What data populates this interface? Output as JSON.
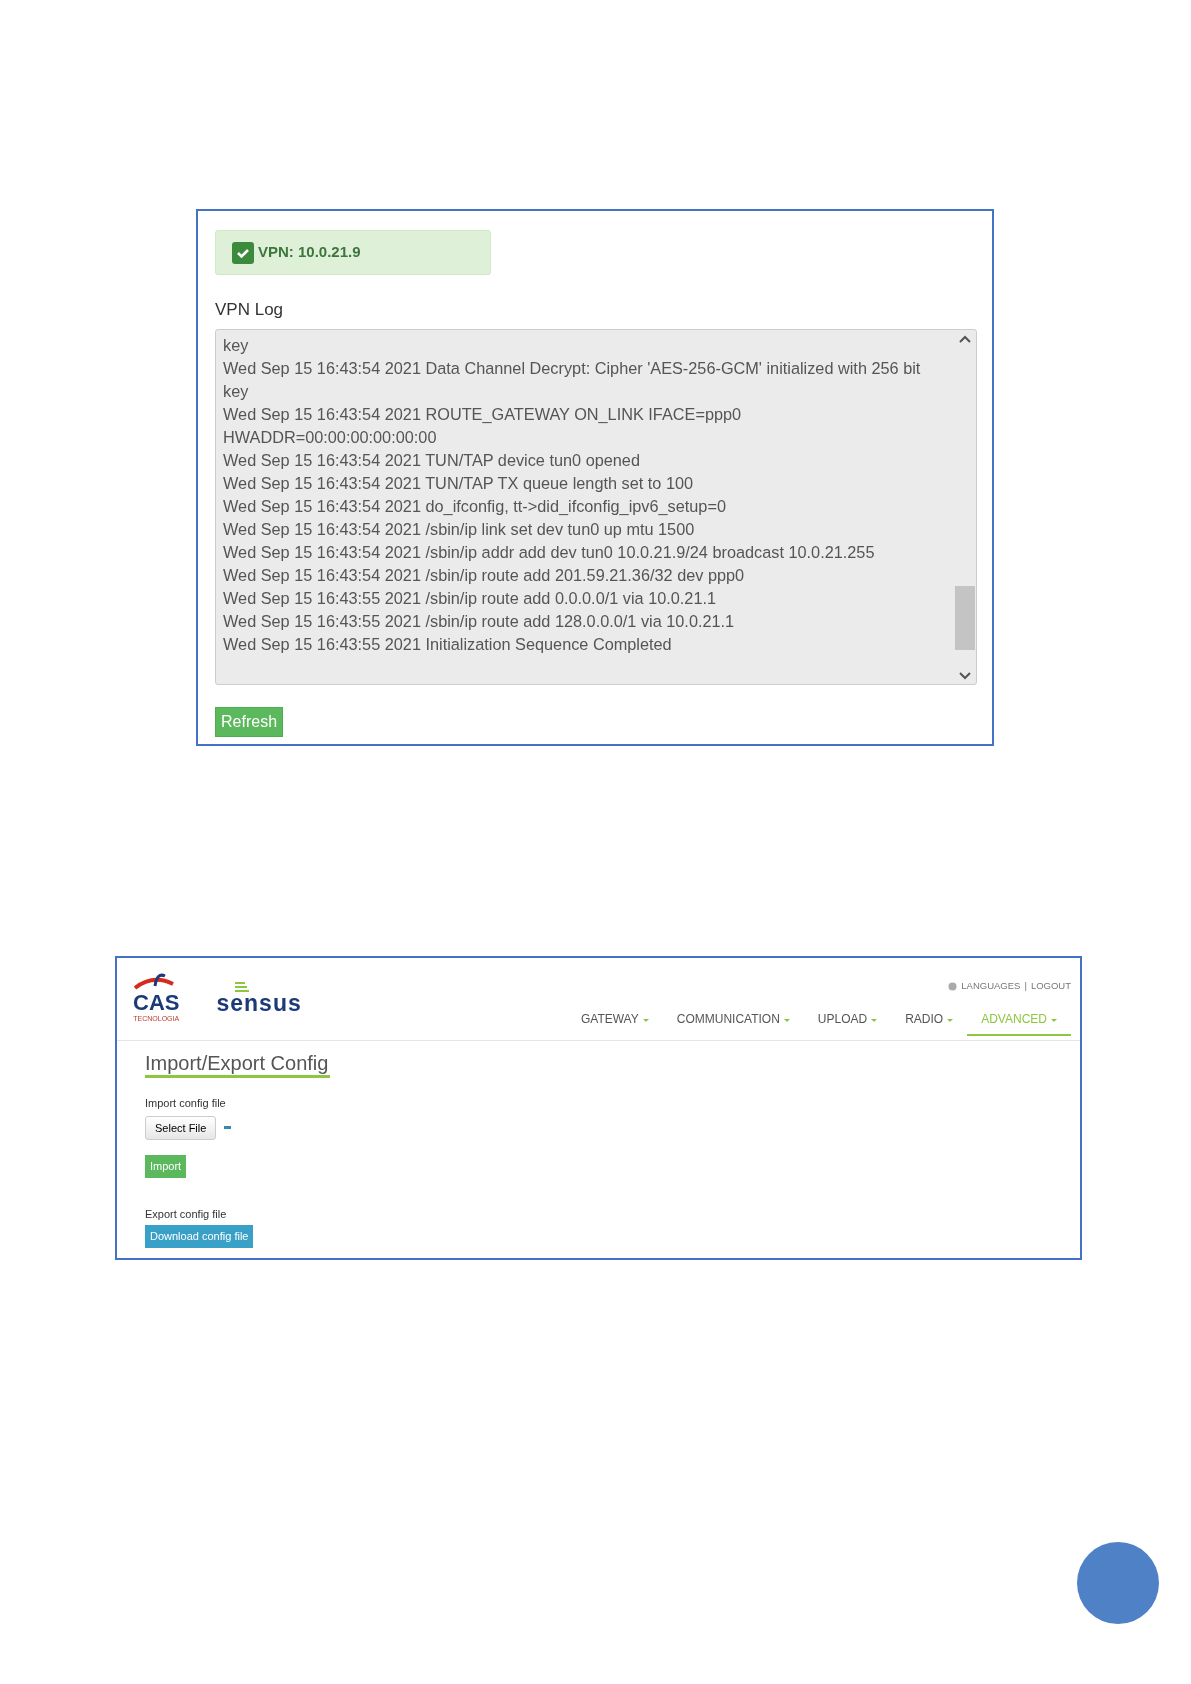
{
  "vpn_panel": {
    "status": {
      "text": "VPN: 10.0.21.9",
      "ok": true
    },
    "log_label": "VPN Log",
    "log_lines": [
      "key",
      "Wed Sep 15 16:43:54 2021 Data Channel Decrypt: Cipher 'AES-256-GCM' initialized with 256 bit",
      "key",
      "Wed Sep 15 16:43:54 2021 ROUTE_GATEWAY ON_LINK IFACE=ppp0",
      "HWADDR=00:00:00:00:00:00",
      "Wed Sep 15 16:43:54 2021 TUN/TAP device tun0 opened",
      "Wed Sep 15 16:43:54 2021 TUN/TAP TX queue length set to 100",
      "Wed Sep 15 16:43:54 2021 do_ifconfig, tt->did_ifconfig_ipv6_setup=0",
      "Wed Sep 15 16:43:54 2021 /sbin/ip link set dev tun0 up mtu 1500",
      "Wed Sep 15 16:43:54 2021 /sbin/ip addr add dev tun0 10.0.21.9/24 broadcast 10.0.21.255",
      "Wed Sep 15 16:43:54 2021 /sbin/ip route add 201.59.21.36/32 dev ppp0",
      "Wed Sep 15 16:43:55 2021 /sbin/ip route add 0.0.0.0/1 via 10.0.21.1",
      "Wed Sep 15 16:43:55 2021 /sbin/ip route add 128.0.0.0/1 via 10.0.21.1",
      "Wed Sep 15 16:43:55 2021 Initialization Sequence Completed"
    ],
    "refresh_button": "Refresh"
  },
  "config_panel": {
    "logo_cas": {
      "name": "CAS",
      "subtitle": "TECNOLOGIA"
    },
    "logo_sensus": "sensus",
    "top_links": [
      "LANGUAGES",
      "LOGOUT"
    ],
    "top_links_separator": "|",
    "nav": [
      {
        "label": "GATEWAY",
        "selected": false
      },
      {
        "label": "COMMUNICATION",
        "selected": false
      },
      {
        "label": "UPLOAD",
        "selected": false
      },
      {
        "label": "RADIO",
        "selected": false
      },
      {
        "label": "ADVANCED",
        "selected": true
      }
    ],
    "title": "Import/Export Config",
    "import_label": "Import config file",
    "select_button": "Select File",
    "import_button": "Import",
    "export_label": "Export config file",
    "download_button": "Download config file"
  }
}
